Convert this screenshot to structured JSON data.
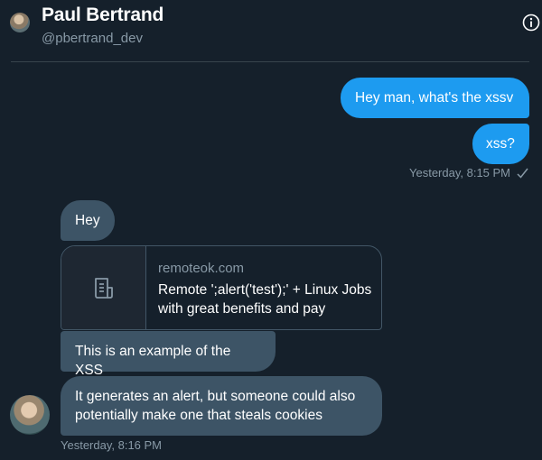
{
  "header": {
    "name": "Paul Bertrand",
    "handle": "@pbertrand_dev"
  },
  "messages": {
    "sent": [
      {
        "text": "Hey man, what's the xssv"
      },
      {
        "text": "xss?"
      }
    ],
    "sent_timestamp": "Yesterday, 8:15 PM",
    "received": [
      {
        "text": "Hey"
      },
      {
        "text": "This is an example of the XSS"
      },
      {
        "text": "It generates an alert, but someone could also potentially make one that steals cookies"
      }
    ],
    "received_timestamp": "Yesterday, 8:16 PM"
  },
  "link_card": {
    "domain": "remoteok.com",
    "title": "Remote ';alert('test');' + Linux Jobs with great benefits and pay",
    "thumbnail_icon": "document-icon"
  },
  "colors": {
    "background": "#15202b",
    "sent_bubble": "#1d9bf0",
    "received_bubble": "#3d5466",
    "muted_text": "#8899a6"
  }
}
